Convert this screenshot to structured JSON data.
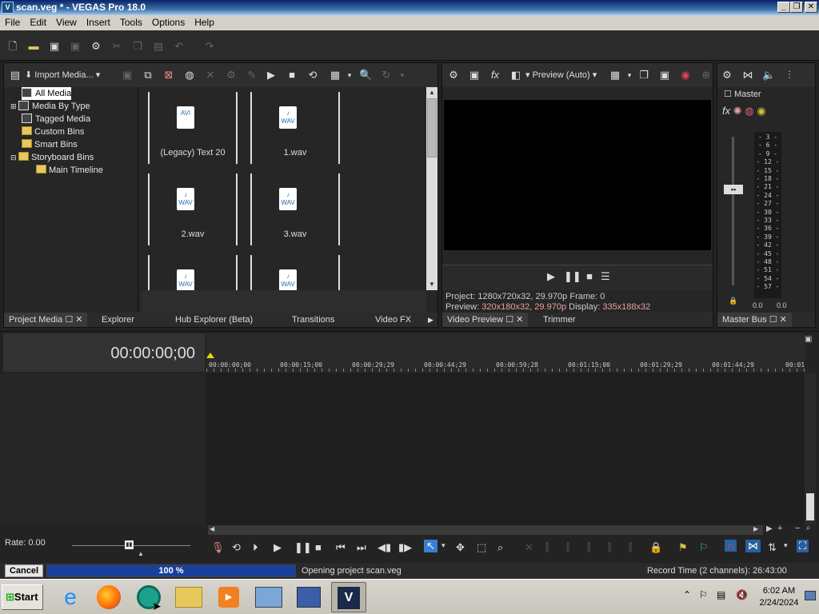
{
  "window": {
    "title": "scan.veg * - VEGAS Pro 18.0",
    "app_icon": "V"
  },
  "menu": [
    "File",
    "Edit",
    "View",
    "Insert",
    "Tools",
    "Options",
    "Help"
  ],
  "project_media": {
    "import_label": "Import Media...",
    "tree": [
      "All Media",
      "Media By Type",
      "Tagged Media",
      "Custom Bins",
      "Smart Bins",
      "Storyboard Bins",
      "Main Timeline"
    ],
    "files": [
      {
        "name": "(Legacy) Text 20",
        "type": "AVI"
      },
      {
        "name": "1.wav",
        "type": "WAV"
      },
      {
        "name": "2.wav",
        "type": "WAV"
      },
      {
        "name": "3.wav",
        "type": "WAV"
      },
      {
        "name": "",
        "type": "WAV"
      },
      {
        "name": "",
        "type": "WAV"
      }
    ],
    "tabs": [
      "Project Media",
      "Explorer",
      "Hub Explorer (Beta)",
      "Transitions",
      "Video FX"
    ]
  },
  "preview": {
    "mode_label": "Preview (Auto)",
    "project_label": "Project:",
    "project_value": "1280x720x32, 29.970p",
    "frame_label": "Frame:",
    "frame_value": "0",
    "preview_label": "Preview:",
    "preview_value": "320x180x32, 29.970p",
    "display_label": "Display:",
    "display_value": "335x188x32",
    "tabs": [
      "Video Preview",
      "Trimmer"
    ]
  },
  "master": {
    "label": "Master",
    "fx_label": "fx",
    "scale": [
      "3",
      "6",
      "9",
      "12",
      "15",
      "18",
      "21",
      "24",
      "27",
      "30",
      "33",
      "36",
      "39",
      "42",
      "45",
      "48",
      "51",
      "54",
      "57"
    ],
    "left_value": "0.0",
    "right_value": "0.0",
    "tab": "Master Bus"
  },
  "timeline": {
    "timecode": "00:00:00;00",
    "ruler": [
      "00:00:00;00",
      "00:00:15;00",
      "00:00:29;29",
      "00:00:44;29",
      "00:00:59;28",
      "00:01:15;00",
      "00:01:29;29",
      "00:01:44;29",
      "00:01"
    ],
    "rate_label": "Rate: 0.00"
  },
  "status": {
    "cancel_label": "Cancel",
    "progress_percent": "100 %",
    "progress": 1.0,
    "message": "Opening project scan.veg",
    "record_time": "Record Time (2 channels): 26:43:00"
  },
  "taskbar": {
    "start_label": "Start",
    "clock_time": "6:02 AM",
    "clock_date": "2/24/2024",
    "apps": [
      "internet-explorer-icon",
      "firefox-icon",
      "chrome-like-icon",
      "file-explorer-icon",
      "media-player-icon",
      "control-panel-icon",
      "security-icon",
      "vegas-icon"
    ]
  },
  "colors": {
    "accent": "#3a6ea5",
    "highlight_text": "#e8a0a0",
    "progress": "#1a3f9a"
  }
}
